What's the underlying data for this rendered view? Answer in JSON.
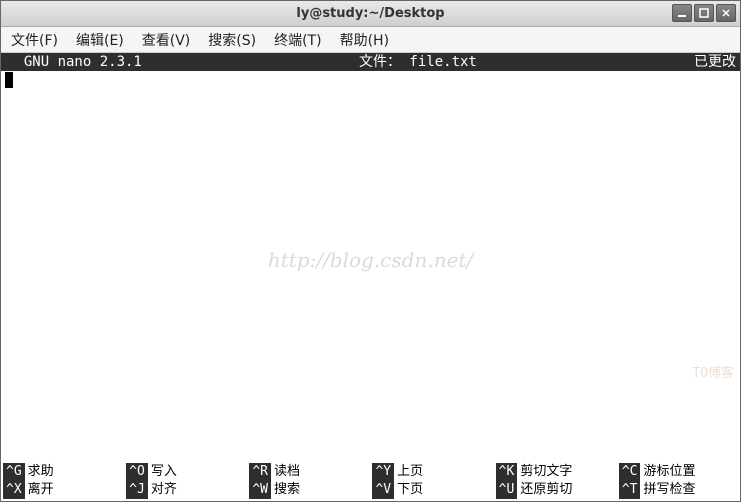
{
  "window": {
    "title": "ly@study:~/Desktop"
  },
  "menubar": {
    "items": [
      {
        "label": "文件(F)"
      },
      {
        "label": "编辑(E)"
      },
      {
        "label": "查看(V)"
      },
      {
        "label": "搜索(S)"
      },
      {
        "label": "终端(T)"
      },
      {
        "label": "帮助(H)"
      }
    ]
  },
  "nano": {
    "version": "  GNU nano 2.3.1",
    "file_label": "文件： file.txt",
    "status": "已更改"
  },
  "watermark": "http://blog.csdn.net/",
  "corner": "TO博客",
  "shortcuts": {
    "row1": [
      {
        "key": "^G",
        "label": "求助"
      },
      {
        "key": "^O",
        "label": "写入"
      },
      {
        "key": "^R",
        "label": "读档"
      },
      {
        "key": "^Y",
        "label": "上页"
      },
      {
        "key": "^K",
        "label": "剪切文字"
      },
      {
        "key": "^C",
        "label": "游标位置"
      }
    ],
    "row2": [
      {
        "key": "^X",
        "label": "离开"
      },
      {
        "key": "^J",
        "label": "对齐"
      },
      {
        "key": "^W",
        "label": "搜索"
      },
      {
        "key": "^V",
        "label": "下页"
      },
      {
        "key": "^U",
        "label": "还原剪切"
      },
      {
        "key": "^T",
        "label": "拼写检查"
      }
    ]
  }
}
